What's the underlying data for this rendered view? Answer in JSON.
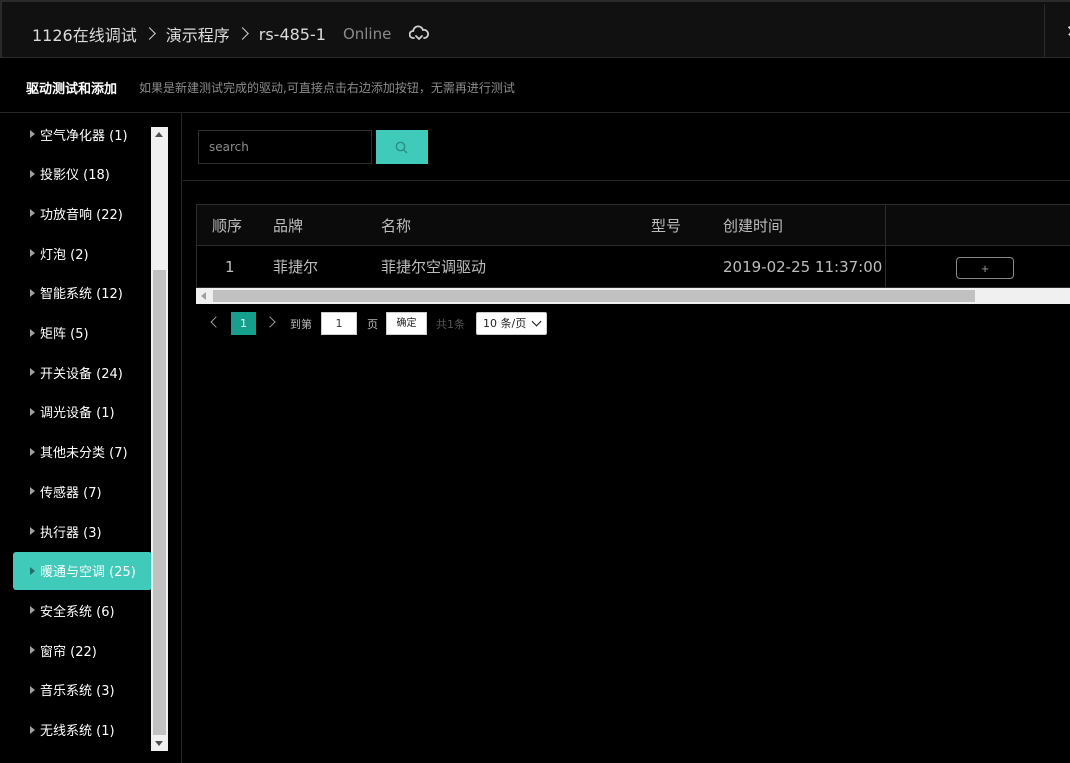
{
  "header": {
    "breadcrumb": [
      "1126在线调试",
      "演示程序",
      "rs-485-1"
    ],
    "status": "Online",
    "status_icon": "cloud-sync-icon",
    "close_icon": "close-icon"
  },
  "subheader": {
    "title": "驱动测试和添加",
    "hint": "如果是新建测试完成的驱动,可直接点击右边添加按钮，无需再进行测试"
  },
  "sidebar": {
    "items": [
      {
        "label": "空气净化器 (1)",
        "active": false
      },
      {
        "label": "投影仪 (18)",
        "active": false
      },
      {
        "label": "功放音响 (22)",
        "active": false
      },
      {
        "label": "灯泡 (2)",
        "active": false
      },
      {
        "label": "智能系统 (12)",
        "active": false
      },
      {
        "label": "矩阵 (5)",
        "active": false
      },
      {
        "label": "开关设备 (24)",
        "active": false
      },
      {
        "label": "调光设备 (1)",
        "active": false
      },
      {
        "label": "其他未分类 (7)",
        "active": false
      },
      {
        "label": "传感器 (7)",
        "active": false
      },
      {
        "label": "执行器 (3)",
        "active": false
      },
      {
        "label": "暖通与空调 (25)",
        "active": true
      },
      {
        "label": "安全系统 (6)",
        "active": false
      },
      {
        "label": "窗帘 (22)",
        "active": false
      },
      {
        "label": "音乐系统 (3)",
        "active": false
      },
      {
        "label": "无线系统 (1)",
        "active": false
      }
    ]
  },
  "search": {
    "placeholder": "search",
    "value": "",
    "button_icon": "search-icon"
  },
  "table": {
    "columns": [
      "顺序",
      "品牌",
      "名称",
      "型号",
      "创建时间"
    ],
    "rows": [
      {
        "index": "1",
        "brand": "菲捷尔",
        "name": "菲捷尔空调驱动",
        "model": "",
        "created": "2019-02-25 11:37:00",
        "action": "+"
      }
    ]
  },
  "pagination": {
    "current_page": "1",
    "goto_label": "到第",
    "goto_value": "1",
    "page_label": "页",
    "confirm_label": "确定",
    "total_label": "共1条",
    "page_size": "10 条/页"
  },
  "colors": {
    "accent": "#3fcab9",
    "page_active": "#14a08d",
    "background": "#000000"
  }
}
